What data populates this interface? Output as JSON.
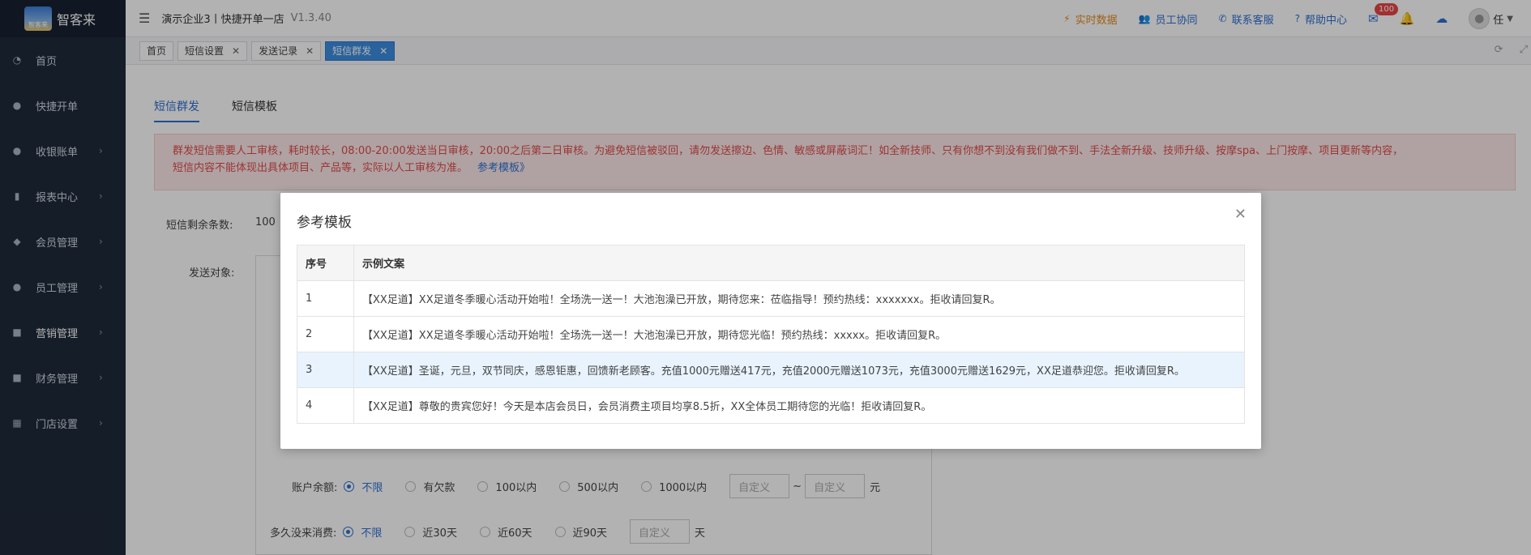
{
  "brand": {
    "name": "智客来",
    "mark": "智客来"
  },
  "sidebar": {
    "items": [
      {
        "label": "首页",
        "icon": "dashboard-icon",
        "chevron": false
      },
      {
        "label": "快捷开单",
        "icon": "bag-icon",
        "chevron": false
      },
      {
        "label": "收银账单",
        "icon": "money-bag-icon",
        "chevron": true
      },
      {
        "label": "报表中心",
        "icon": "bar-chart-icon",
        "chevron": true
      },
      {
        "label": "会员管理",
        "icon": "diamond-icon",
        "chevron": true
      },
      {
        "label": "员工管理",
        "icon": "person-icon",
        "chevron": true
      },
      {
        "label": "营销管理",
        "icon": "briefcase-icon",
        "chevron": true
      },
      {
        "label": "财务管理",
        "icon": "finance-icon",
        "chevron": true
      },
      {
        "label": "门店设置",
        "icon": "grid-icon",
        "chevron": true
      }
    ]
  },
  "topbar": {
    "shop": "演示企业3丨快捷开单一店",
    "version": "V1.3.40",
    "realtime": "实时数据",
    "collab": "员工协同",
    "service": "联系客服",
    "help": "帮助中心",
    "msg_count": "100",
    "user": "任"
  },
  "tabs": [
    {
      "label": "首页",
      "closable": false,
      "active": false
    },
    {
      "label": "短信设置",
      "closable": true,
      "active": false
    },
    {
      "label": "发送记录",
      "closable": true,
      "active": false
    },
    {
      "label": "短信群发",
      "closable": true,
      "active": true
    }
  ],
  "page": {
    "subtab_send": "短信群发",
    "subtab_template": "短信模板",
    "notice_line1": "群发短信需要人工审核，耗时较长，08:00-20:00发送当日审核，20:00之后第二日审核。为避免短信被驳回，请勿发送擦边、色情、敏感或屏蔽词汇！如全新技师、只有你想不到没有我们做不到、手法全新升级、技师升级、按摩spa、上门按摩、项目更新等内容，",
    "notice_line2": "短信内容不能体现出具体项目、产品等，实际以人工审核为准。",
    "notice_link": "参考模板》",
    "remain_label": "短信剩余条数:",
    "remain_value": "100",
    "target_label": "发送对象:",
    "balance_label": "账户余额:",
    "balance_options": [
      "不限",
      "有欠款",
      "100以内",
      "500以内",
      "1000以内"
    ],
    "custom_placeholder": "自定义",
    "tilde": "~",
    "yuan": "元",
    "since_label": "多久没来消费:",
    "since_options": [
      "不限",
      "近30天",
      "近60天",
      "近90天"
    ],
    "day": "天"
  },
  "modal": {
    "title": "参考模板",
    "columns": [
      "序号",
      "示例文案"
    ],
    "rows": [
      {
        "no": "1",
        "text": "【XX足道】XX足道冬季暖心活动开始啦！全场洗一送一！大池泡澡已开放，期待您来：莅临指导！预约热线：xxxxxxx。拒收请回复R。"
      },
      {
        "no": "2",
        "text": "【XX足道】XX足道冬季暖心活动开始啦！全场洗一送一！大池泡澡已开放，期待您光临！预约热线：xxxxx。拒收请回复R。"
      },
      {
        "no": "3",
        "text": "【XX足道】圣诞，元旦，双节同庆，感恩钜惠，回馈新老顾客。充值1000元赠送417元，充值2000元赠送1073元，充值3000元赠送1629元，XX足道恭迎您。拒收请回复R。"
      },
      {
        "no": "4",
        "text": "【XX足道】尊敬的贵宾您好！今天是本店会员日，会员消费主项目均享8.5折，XX全体员工期待您的光临！拒收请回复R。"
      }
    ]
  },
  "colors": {
    "primary": "#2d6fd3",
    "sidebar": "#1f2a3a",
    "notice": "#e04b4b"
  }
}
